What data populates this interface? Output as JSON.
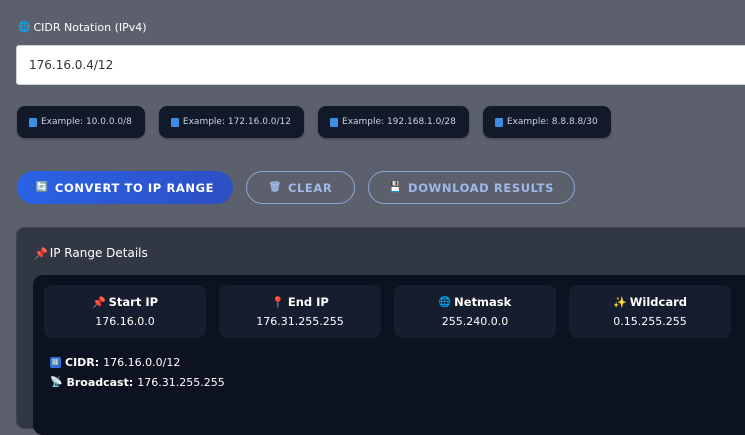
{
  "form": {
    "label": "CIDR Notation (IPv4)",
    "input_value": "176.16.0.4/12",
    "examples": [
      "Example: 10.0.0.0/8",
      "Example: 172.16.0.0/12",
      "Example: 192.168.1.0/28",
      "Example: 8.8.8.8/30"
    ]
  },
  "buttons": {
    "convert": "CONVERT TO IP RANGE",
    "clear": "CLEAR",
    "download": "DOWNLOAD RESULTS"
  },
  "results": {
    "title": "IP Range Details",
    "start_ip": {
      "label": "Start IP",
      "value": "176.16.0.0"
    },
    "end_ip": {
      "label": "End IP",
      "value": "176.31.255.255"
    },
    "netmask": {
      "label": "Netmask",
      "value": "255.240.0.0"
    },
    "wildcard": {
      "label": "Wildcard",
      "value": "0.15.255.255"
    },
    "cidr": {
      "label": "CIDR:",
      "value": "176.16.0.0/12"
    },
    "broadcast": {
      "label": "Broadcast:",
      "value": "176.31.255.255"
    }
  },
  "colors": {
    "background": "#5c606d",
    "primary_button": "#2a62e6",
    "panel": "#323744",
    "inner_panel": "#0c121f",
    "card": "#161d2e"
  },
  "icons": {
    "label": "globe-icon",
    "examples": "book-icon",
    "convert": "refresh-icon",
    "clear": "trash-icon",
    "download": "floppy-disk-icon",
    "title": "pushpin-icon",
    "start_ip": "pushpin-icon",
    "end_ip": "map-pin-icon",
    "netmask": "globe-icon",
    "wildcard": "sparkles-icon",
    "cidr": "numbers-icon",
    "broadcast": "broadcast-icon"
  }
}
